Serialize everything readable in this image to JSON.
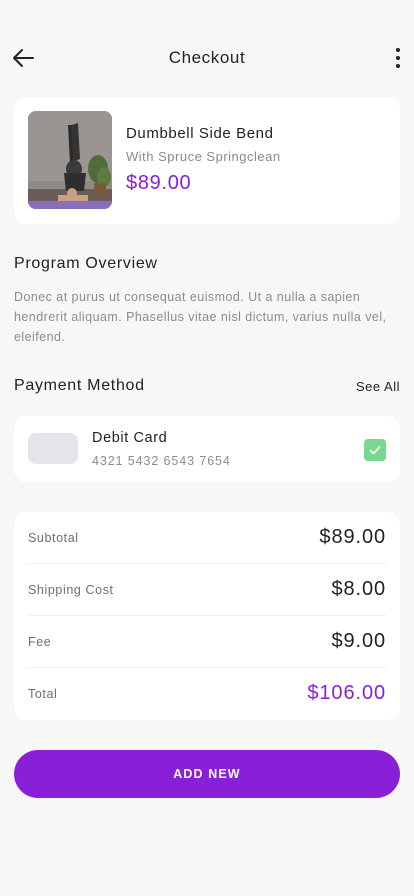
{
  "header": {
    "title": "Checkout"
  },
  "product": {
    "name": "Dumbbell Side Bend",
    "subtitle": "With Spruce Springclean",
    "price": "$89.00"
  },
  "overview": {
    "title": "Program Overview",
    "text": "Donec at purus ut consequat euismod. Ut a nulla a sapien hendrerit aliquam. Phasellus vitae nisl dictum, varius nulla vel, eleifend."
  },
  "payment": {
    "title": "Payment Method",
    "see_all": "See All",
    "card_name": "Debit Card",
    "card_number": "4321 5432 6543 7654",
    "selected": true
  },
  "summary": {
    "rows": [
      {
        "label": "Subtotal",
        "value": "$89.00"
      },
      {
        "label": "Shipping Cost",
        "value": "$8.00"
      },
      {
        "label": "Fee",
        "value": "$9.00"
      },
      {
        "label": "Total",
        "value": "$106.00"
      }
    ]
  },
  "actions": {
    "add_new": "ADD NEW"
  },
  "colors": {
    "accent": "#8a1fd8",
    "check": "#78d890",
    "background": "#f7f7f8"
  }
}
